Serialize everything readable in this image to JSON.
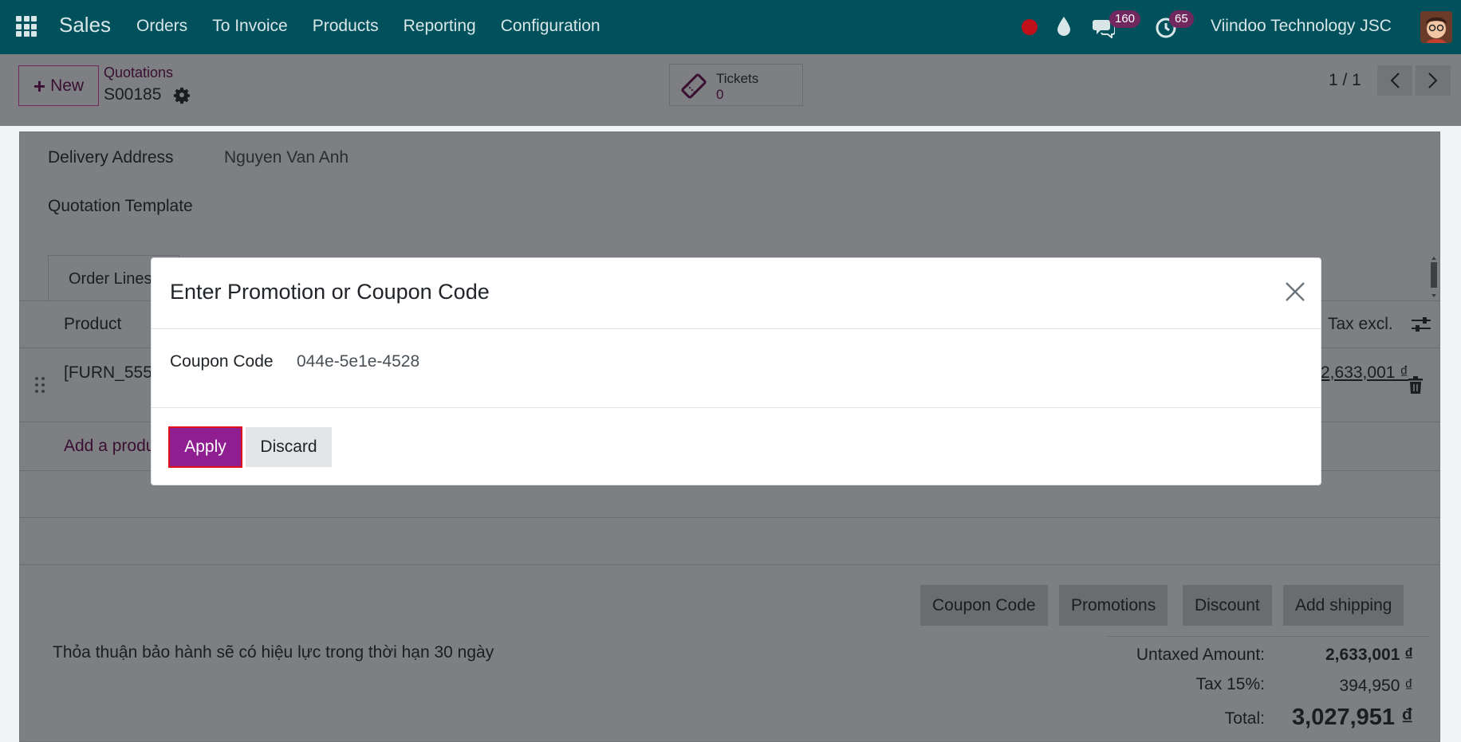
{
  "navbar": {
    "app_name": "Sales",
    "menu": [
      "Orders",
      "To Invoice",
      "Products",
      "Reporting",
      "Configuration"
    ],
    "messages_count": "160",
    "activities_count": "65",
    "company": "Viindoo Technology JSC"
  },
  "control_panel": {
    "new_label": "New",
    "breadcrumb": "Quotations",
    "record_name": "S00185",
    "smart_button": {
      "label": "Tickets",
      "value": "0"
    },
    "pager": "1 / 1"
  },
  "form": {
    "delivery_address_label": "Delivery Address",
    "delivery_address_value": "Nguyen Van Anh",
    "quotation_template_label": "Quotation Template",
    "tab_order_lines": "Order Lines",
    "columns": {
      "product": "Product",
      "tax_excl": "Tax excl."
    },
    "line": {
      "product": "[FURN_555",
      "amount": "2,633,001 ₫"
    },
    "add_product": "Add a product",
    "actions": [
      "Coupon Code",
      "Promotions",
      "Discount",
      "Add shipping"
    ],
    "note": "Thỏa thuận bảo hành sẽ có hiệu lực trong thời hạn 30 ngày",
    "totals": {
      "untaxed_label": "Untaxed Amount:",
      "untaxed_value": "2,633,001 ₫",
      "tax_label": "Tax 15%:",
      "tax_value": "394,950 ₫",
      "total_label": "Total:",
      "total_value": "3,027,951 ₫"
    }
  },
  "modal": {
    "title": "Enter Promotion or Coupon Code",
    "coupon_label": "Coupon Code",
    "coupon_value": "044e-5e1e-4528",
    "apply_label": "Apply",
    "discard_label": "Discard"
  },
  "colors": {
    "navbar": "#00515c",
    "primary": "#71285f",
    "apply_button": "#8f1e91",
    "highlight_border": "#e0131c"
  },
  "icons": [
    "apps-icon",
    "record-icon",
    "drop-icon",
    "chat-icon",
    "clock-icon",
    "gear-icon",
    "ticket-icon",
    "chevron-left-icon",
    "chevron-right-icon",
    "sliders-icon",
    "drag-handle-icon",
    "trash-icon",
    "close-icon",
    "plus-icon"
  ]
}
